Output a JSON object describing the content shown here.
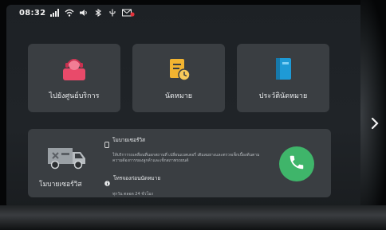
{
  "status_bar": {
    "time": "08:32",
    "icons": [
      "signal-icon",
      "wifi-icon",
      "sound-icon",
      "bluetooth-icon",
      "usb-icon",
      "mail-alert-icon"
    ]
  },
  "tiles": [
    {
      "label": "ไปยังศูนย์บริการ",
      "icon": "service-center-icon",
      "color": "#e94a6a"
    },
    {
      "label": "นัดหมาย",
      "icon": "appointment-icon",
      "color": "#f2b431"
    },
    {
      "label": "ประวัตินัดหมาย",
      "icon": "appointment-history-icon",
      "color": "#1e9ad6"
    }
  ],
  "service_card": {
    "van_label": "โมบายเซอร์วิส",
    "title": "โมบายเซอร์วิส",
    "description": "ให้บริการรถเคลื่อนที่นอกสถานที่ เปลี่ยนแบตเตอรี่ เติมลมยางและตรวจเช็กเบื้องต้นตามความต้องการของลูกค้าและเช็กสภาพรถยนต์",
    "hotline_title": "โทรจองก่อนนัดหมาย",
    "hotline_sub": "ทุกวัน ตลอด 24 ชั่วโมง",
    "call_color": "#3fb56a"
  }
}
